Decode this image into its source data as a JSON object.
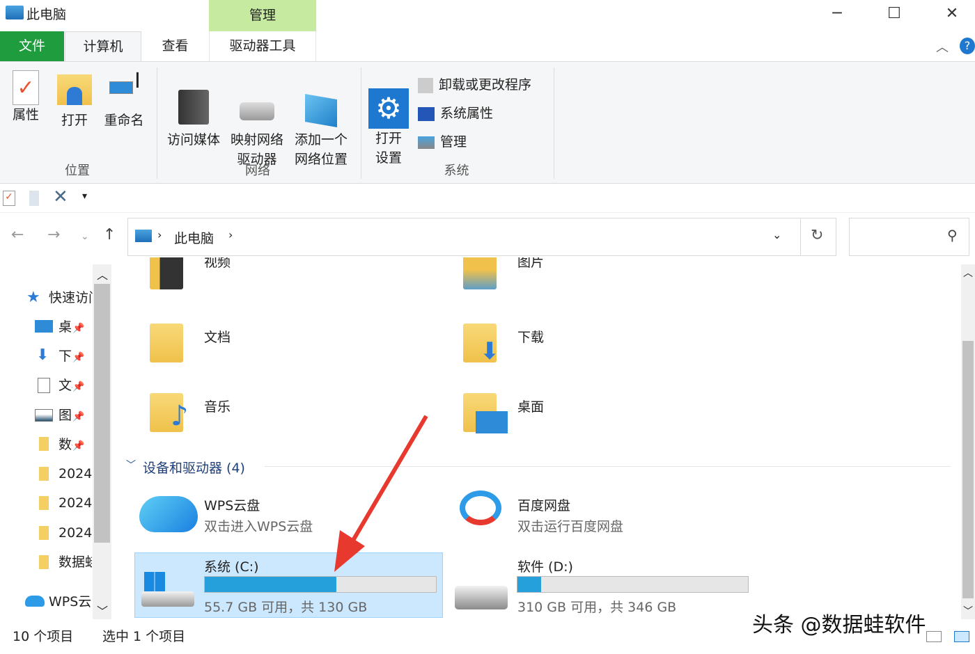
{
  "window": {
    "title": "此电脑",
    "context_tab": "管理",
    "controls": {
      "minimize": "─",
      "maximize": "☐",
      "close": "✕"
    }
  },
  "tabs": [
    {
      "label": "文件"
    },
    {
      "label": "计算机",
      "selected": true
    },
    {
      "label": "查看"
    },
    {
      "label": "驱动器工具"
    }
  ],
  "ribbon": {
    "groups": [
      {
        "label": "位置",
        "buttons": [
          "属性",
          "打开",
          "重命名"
        ]
      },
      {
        "label": "网络",
        "buttons": [
          "访问媒体",
          "映射网络\n驱动器",
          "添加一个\n网络位置"
        ]
      },
      {
        "label": "系统",
        "buttons": [
          "打开\n设置",
          "卸载或更改程序",
          "系统属性",
          "管理"
        ]
      }
    ]
  },
  "breadcrumb": {
    "location": "此电脑"
  },
  "sidebar": {
    "items": [
      {
        "label": "快速访问",
        "icon": "star-icon"
      },
      {
        "label": "桌面",
        "icon": "desktop-icon",
        "pinned": true
      },
      {
        "label": "下载",
        "icon": "download-icon",
        "pinned": true
      },
      {
        "label": "文档",
        "icon": "document-icon",
        "pinned": true
      },
      {
        "label": "图片",
        "icon": "picture-icon",
        "pinned": true
      },
      {
        "label": "数据蛙",
        "icon": "folder-icon",
        "pinned": true
      },
      {
        "label": "2024",
        "icon": "folder-icon"
      },
      {
        "label": "2024",
        "icon": "folder-icon"
      },
      {
        "label": "2024",
        "icon": "folder-icon"
      },
      {
        "label": "数据蛙",
        "icon": "folder-icon"
      },
      {
        "label": "WPS云盘",
        "icon": "cloud-icon"
      }
    ]
  },
  "folders": [
    {
      "name": "视频",
      "icon": "video-folder-icon"
    },
    {
      "name": "图片",
      "icon": "pictures-folder-icon"
    },
    {
      "name": "文档",
      "icon": "documents-folder-icon"
    },
    {
      "name": "下载",
      "icon": "downloads-folder-icon"
    },
    {
      "name": "音乐",
      "icon": "music-folder-icon"
    },
    {
      "name": "桌面",
      "icon": "desktop-folder-icon"
    }
  ],
  "devices_section": {
    "label": "设备和驱动器 (4)"
  },
  "devices": [
    {
      "name": "WPS云盘",
      "sub": "双击进入WPS云盘"
    },
    {
      "name": "百度网盘",
      "sub": "双击运行百度网盘"
    },
    {
      "name": "系统 (C:)",
      "sub": "55.7 GB 可用，共 130 GB",
      "used_fraction": 0.57,
      "selected": true
    },
    {
      "name": "软件 (D:)",
      "sub": "310 GB 可用，共 346 GB",
      "used_fraction": 0.104
    }
  ],
  "status": {
    "count": "10 个项目",
    "selection": "选中 1 个项目"
  },
  "watermark": "头条 @数据蛙软件",
  "colors": {
    "accent": "#26a0da",
    "file_tab": "#1f9d3e",
    "context_tab": "#c5eaa0",
    "selection": "#cce8ff",
    "arrow": "#e8392f"
  }
}
